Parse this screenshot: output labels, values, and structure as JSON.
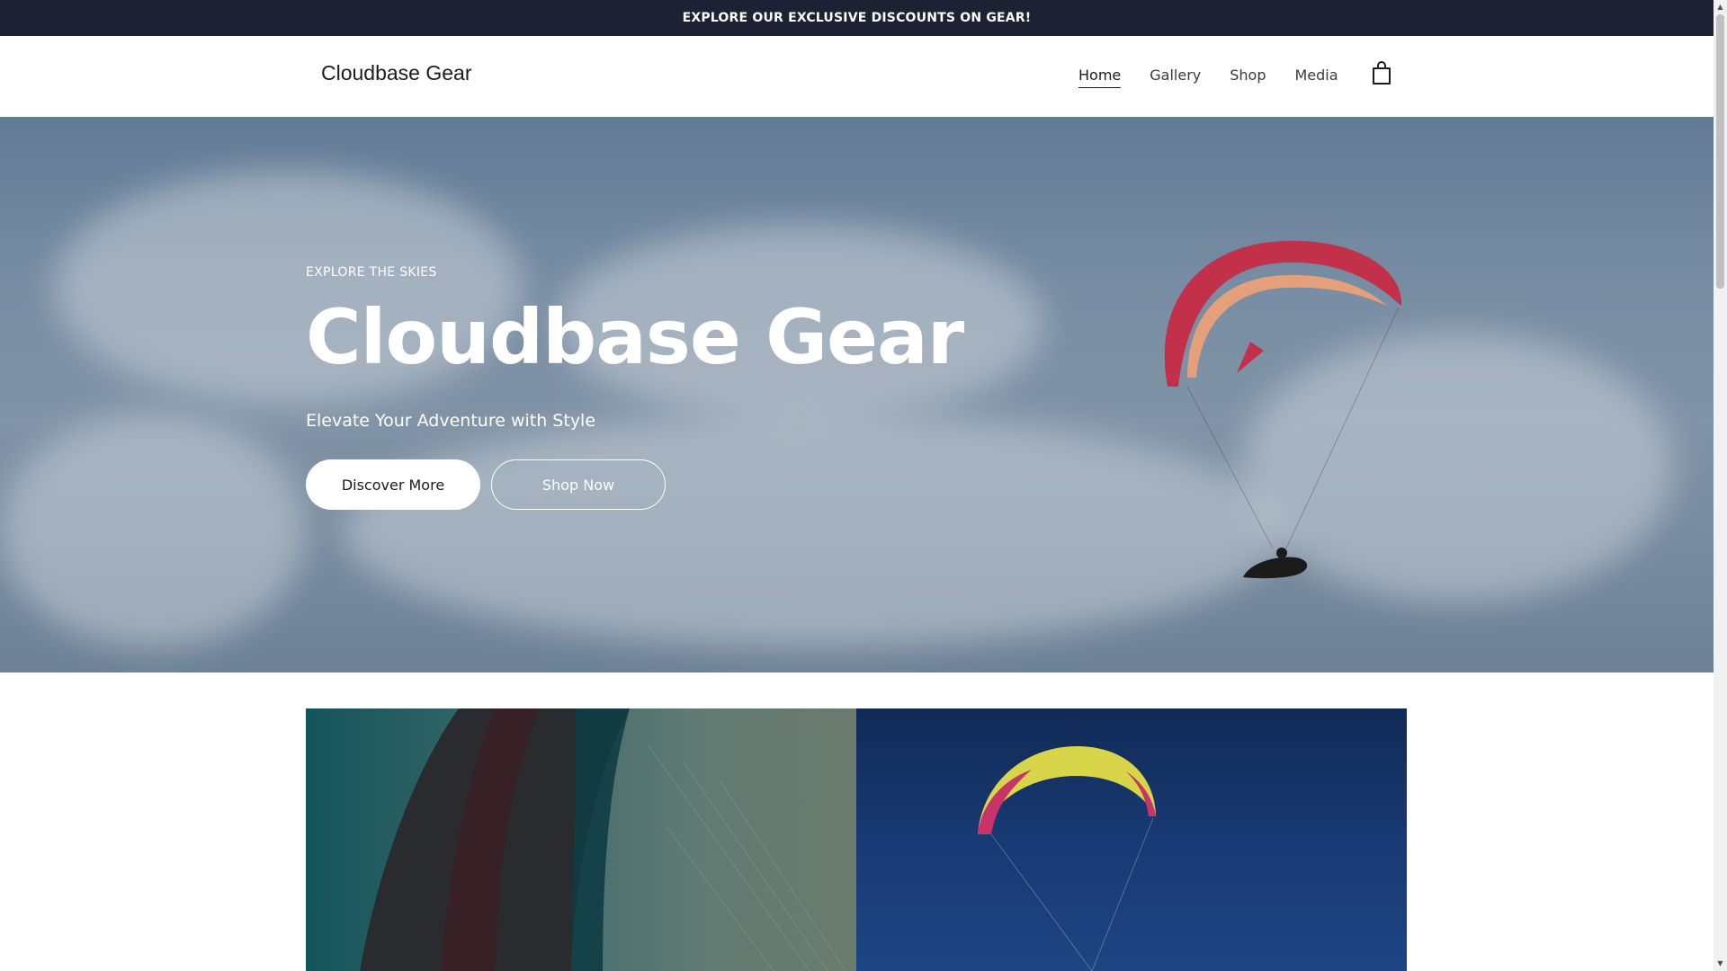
{
  "announcement": {
    "text": "EXPLORE OUR EXCLUSIVE DISCOUNTS ON GEAR!"
  },
  "header": {
    "brand": "Cloudbase Gear",
    "nav": [
      {
        "label": "Home",
        "active": true
      },
      {
        "label": "Gallery",
        "active": false
      },
      {
        "label": "Shop",
        "active": false
      },
      {
        "label": "Media",
        "active": false
      }
    ],
    "cart_icon": "shopping-bag-icon"
  },
  "hero": {
    "eyebrow": "EXPLORE THE SKIES",
    "title": "Cloudbase Gear",
    "subtitle": "Elevate Your Adventure with Style",
    "primary_button": "Discover More",
    "secondary_button": "Shop Now"
  },
  "colors": {
    "announcement_bg": "#1c2233",
    "wing_red": "#c2304a",
    "wing_yellow": "#d9d548"
  }
}
